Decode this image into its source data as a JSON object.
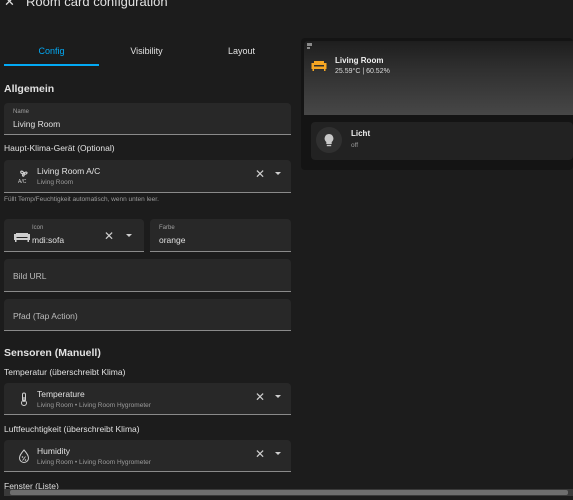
{
  "header": {
    "title": "Room card configuration",
    "close_icon": "close-icon"
  },
  "tabs": [
    {
      "label": "Config"
    },
    {
      "label": "Visibility"
    },
    {
      "label": "Layout"
    }
  ],
  "general": {
    "section_title": "Allgemein",
    "name_field": {
      "label": "Name",
      "value": "Living Room"
    },
    "climate_label": "Haupt-Klima-Gerät (Optional)",
    "climate_entity": {
      "name": "Living Room A/C",
      "area": "Living Room",
      "icon": "air-conditioner-icon"
    },
    "climate_helper": "Füllt Temp/Feuchtigkeit automatisch, wenn unten leer.",
    "icon_field": {
      "label": "Icon",
      "value": "mdi:sofa",
      "icon": "sofa-icon"
    },
    "color_field": {
      "label": "Farbe",
      "value": "orange"
    },
    "image_url_placeholder": "Bild URL",
    "path_placeholder": "Pfad (Tap Action)"
  },
  "sensors": {
    "section_title": "Sensoren (Manuell)",
    "temperature_label": "Temperatur (überschreibt Klima)",
    "temperature_entity": {
      "name": "Temperature",
      "sub": "Living Room • Living Room Hygrometer",
      "icon": "thermometer-icon"
    },
    "humidity_label": "Luftfeuchtigkeit (überschreibt Klima)",
    "humidity_entity": {
      "name": "Humidity",
      "sub": "Living Room • Living Room Hygrometer",
      "icon": "water-percent-icon"
    },
    "windows_label": "Fenster (Liste)"
  },
  "preview": {
    "room_name": "Living Room",
    "room_stats": "25.59°C | 60.52%",
    "room_icon": "sofa-icon",
    "light": {
      "name": "Licht",
      "state": "off",
      "icon": "lightbulb-icon"
    }
  },
  "colors": {
    "accent": "#03a9f4",
    "room_icon": "#f5a623"
  }
}
